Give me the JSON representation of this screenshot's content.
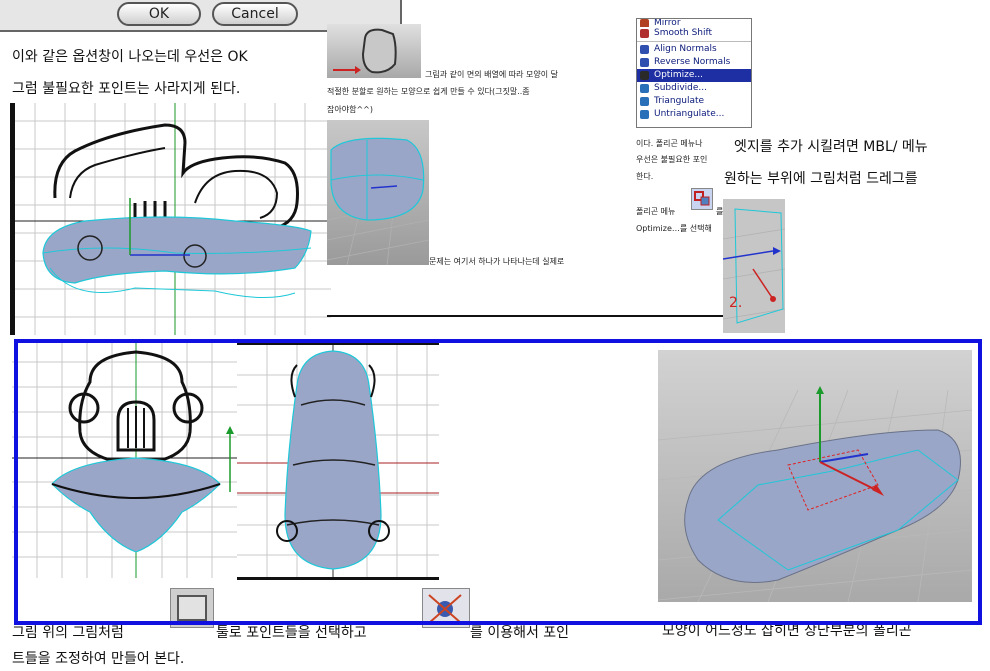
{
  "dialog": {
    "ok_label": "OK",
    "cancel_label": "Cancel"
  },
  "text": {
    "line1": "이와 같은 옵션창이 나오는데 우선은 OK",
    "line2": "그럼 불필요한 포인트는 사라지게 된다.",
    "mid1": "그림과 같이 면의 배열에 따라 모양이 달",
    "mid2": "적절한 분할로 원하는 모양으로 쉽게 만들 수 있다(그짓말..좀",
    "mid3": "잡아야함^^)",
    "mid4": "문제는 여기서 하나가 나타나는데 실제로",
    "right1": "이다. 폴리곤 메뉴나",
    "right2": "우선은 불필요한 포인",
    "right3": "한다.",
    "right4": "폴리곤 메뉴",
    "right4b": "를",
    "right5": "Optimize…를 선택해",
    "edge1": "엣지를 추가 시킬려면 MBL/ 메뉴",
    "edge2": "원하는 부위에 그림처럼 드레그를",
    "step_label": "2.",
    "bottom1_pre": "그림 위의 그림처럼",
    "bottom1_mid": "툴로 포인트들을 선택하고",
    "bottom1_post": "를 이용해서 포인",
    "bottom2": "트들을 조정하여 만들어 본다.",
    "bottom_right": "모양이 어느정도 잡히면 상단부분의 폴리곤"
  },
  "menu": {
    "items": [
      {
        "label": "Mirror",
        "icon": "mirror-icon",
        "selected": false
      },
      {
        "label": "Smooth Shift",
        "icon": "smooth-shift-icon",
        "selected": false
      },
      {
        "label": "Align Normals",
        "icon": "align-normals-icon",
        "selected": false
      },
      {
        "label": "Reverse Normals",
        "icon": "reverse-normals-icon",
        "selected": false
      },
      {
        "label": "Optimize...",
        "icon": "optimize-icon",
        "selected": true
      },
      {
        "label": "Subdivide...",
        "icon": "subdivide-icon",
        "selected": false
      },
      {
        "label": "Triangulate",
        "icon": "triangulate-icon",
        "selected": false
      },
      {
        "label": "Untriangulate...",
        "icon": "untriangulate-icon",
        "selected": false
      }
    ]
  },
  "colors": {
    "highlight_frame": "#1010e0",
    "mesh_fill": "#9aa6c8",
    "wire_cyan": "#1ec8d8",
    "menu_selected": "#1e2fa4",
    "axis_green": "#1a9a2a",
    "axis_red": "#cc2222",
    "axis_blue": "#2233cc"
  }
}
